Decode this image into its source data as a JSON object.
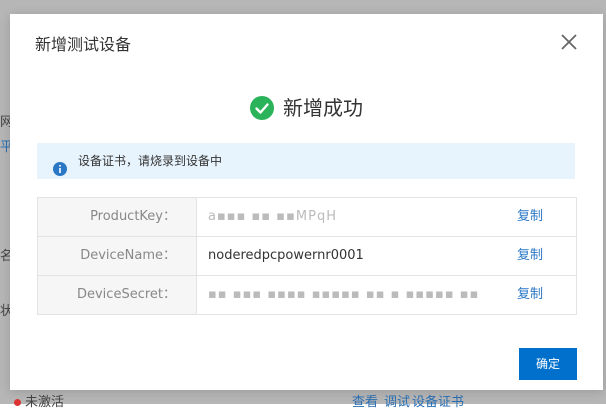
{
  "background": {
    "fragments": [
      "网",
      "平台",
      "名称",
      "状态",
      "未激活",
      "查看",
      "调试",
      "设备证书"
    ]
  },
  "dialog": {
    "title": "新增测试设备",
    "close_icon": "close-icon",
    "success_icon": "check-circle-icon",
    "success_text": "新增成功",
    "info_icon": "info-icon",
    "info_text": "设备证书，请烧录到设备中",
    "rows": [
      {
        "key": "ProductKey：",
        "value": "a▪▪▪ ▪▪ ▪▪MPqH",
        "copy": "复制"
      },
      {
        "key": "DeviceName：",
        "value": "noderedpcpowernr0001",
        "copy": "复制"
      },
      {
        "key": "DeviceSecret：",
        "value": "▪▪ ▪▪▪ ▪▪▪▪ ▪▪▪▪▪ ▪▪ ▪ ▪▪▪▪▪ ▪▪",
        "copy": "复制"
      }
    ],
    "confirm_label": "确定"
  },
  "colors": {
    "primary": "#0070cc",
    "link": "#2a78c5",
    "success": "#2ab35a",
    "info": "#2a78c5",
    "info_bg": "#e8f4fd"
  }
}
